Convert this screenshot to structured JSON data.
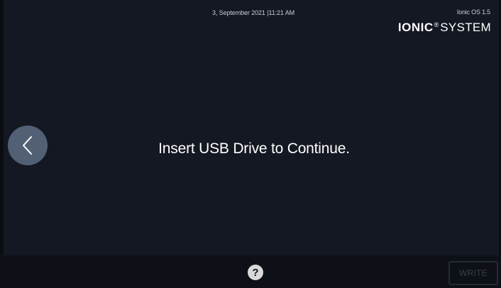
{
  "header": {
    "datetime": "3, September 2021 |11:21 AM",
    "os_version": "Ionic OS 1.5",
    "brand": {
      "bold": "IONIC",
      "registered": "®",
      "light": "SYSTEM"
    }
  },
  "navigation": {
    "back_icon": "chevron-left-icon"
  },
  "main": {
    "message": "Insert USB Drive to Continue."
  },
  "footer": {
    "help_icon": "question-mark-icon",
    "help_glyph": "?",
    "write_label": "WRITE",
    "write_state": "disabled"
  },
  "colors": {
    "background": "#141823",
    "footer_background": "#0d1016",
    "back_button": "#526075",
    "text": "#ffffff",
    "disabled_text": "#3a3f48"
  }
}
